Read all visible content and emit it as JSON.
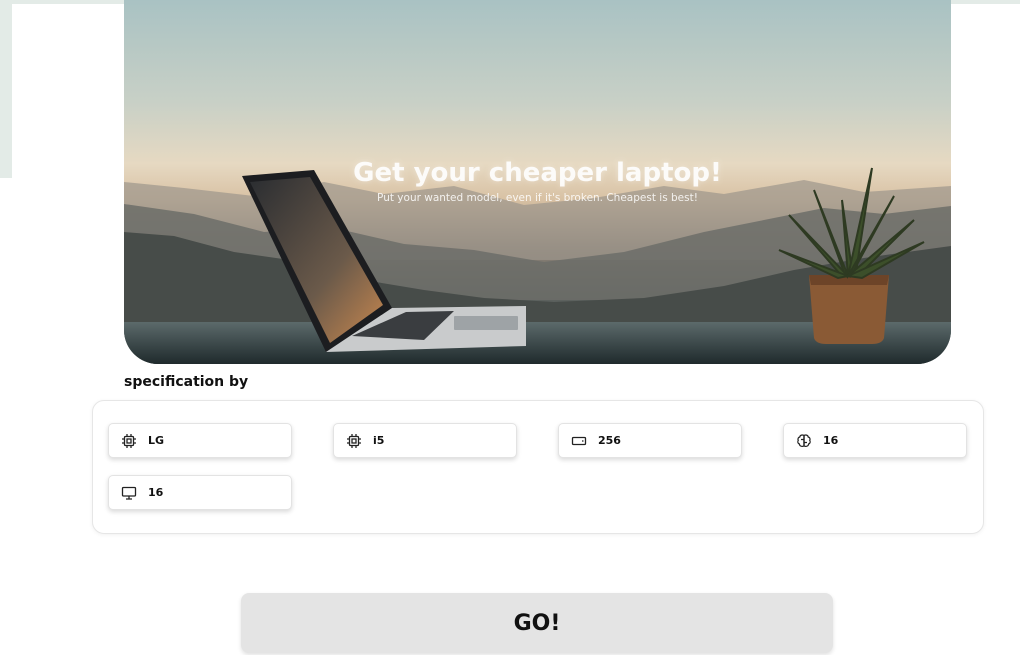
{
  "hero": {
    "title": "Get your cheaper laptop!",
    "subtitle": "Put your wanted model, even if it's broken. Cheapest is best!"
  },
  "specs": {
    "label": "specification by",
    "items": [
      {
        "icon": "cpu-icon",
        "value": "LG"
      },
      {
        "icon": "cpu-icon",
        "value": "i5"
      },
      {
        "icon": "hard-drive-icon",
        "value": "256"
      },
      {
        "icon": "brain-icon",
        "value": "16"
      },
      {
        "icon": "monitor-icon",
        "value": "16"
      }
    ]
  },
  "actions": {
    "go_label": "GO!"
  }
}
